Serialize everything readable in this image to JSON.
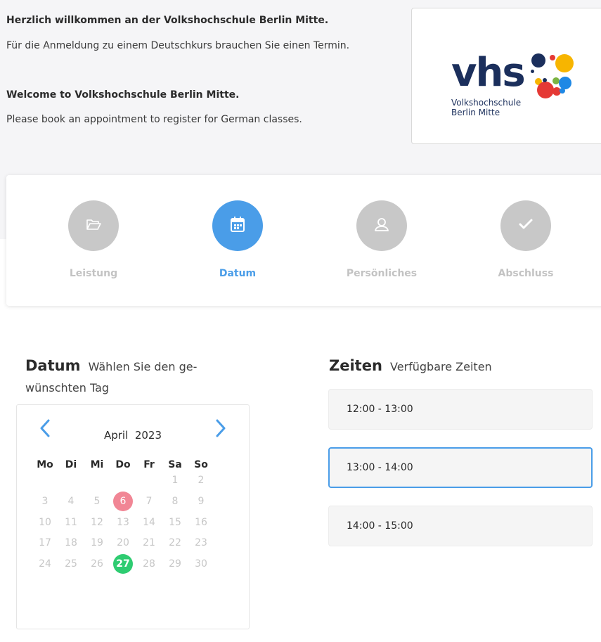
{
  "intro": {
    "de_title": "Herzlich willkommen an der Volkshochschule Berlin Mitte.",
    "de_text": "Für die Anmeldung zu einem Deutschkurs brauchen Sie einen Termin.",
    "en_title": "Welcome to Volkshochschule Berlin Mitte.",
    "en_text": "Please book an appointment to register for German classes."
  },
  "logo": {
    "mark": "vhs",
    "line1": "Volkshochschule",
    "line2": "Berlin Mitte",
    "colors": [
      "#1b2f5c",
      "#f7b500",
      "#e53935",
      "#1e88e5",
      "#7cb342"
    ]
  },
  "steps": [
    {
      "label": "Leistung",
      "icon": "folder-open-icon",
      "active": false
    },
    {
      "label": "Datum",
      "icon": "calendar-icon",
      "active": true
    },
    {
      "label": "Persönliches",
      "icon": "user-icon",
      "active": false
    },
    {
      "label": "Abschluss",
      "icon": "check-icon",
      "active": false
    }
  ],
  "date_section": {
    "title": "Datum",
    "subtitle_line1": "Wählen Sie den ge-",
    "subtitle_line2": "wünschten Tag"
  },
  "calendar": {
    "month": "April",
    "year": "2023",
    "weekdays": [
      "Mo",
      "Di",
      "Mi",
      "Do",
      "Fr",
      "Sa",
      "So"
    ],
    "weeks": [
      [
        "",
        "",
        "",
        "",
        "",
        "1",
        "2"
      ],
      [
        "3",
        "4",
        "5",
        "6",
        "7",
        "8",
        "9"
      ],
      [
        "10",
        "11",
        "12",
        "13",
        "14",
        "15",
        "16"
      ],
      [
        "17",
        "18",
        "19",
        "20",
        "21",
        "22",
        "23"
      ],
      [
        "24",
        "25",
        "26",
        "27",
        "28",
        "29",
        "30"
      ]
    ],
    "today": "6",
    "available": [
      "27"
    ]
  },
  "times_section": {
    "title": "Zeiten",
    "subtitle": "Verfügbare Zeiten",
    "slots": [
      "12:00 - 13:00",
      "13:00 - 14:00",
      "14:00 - 15:00"
    ],
    "selected_slot": "13:00 - 14:00"
  },
  "colors": {
    "accent": "#4a9de8",
    "step_inactive": "#c8c8c8",
    "today": "#f07a8a",
    "available": "#2ecc71"
  }
}
